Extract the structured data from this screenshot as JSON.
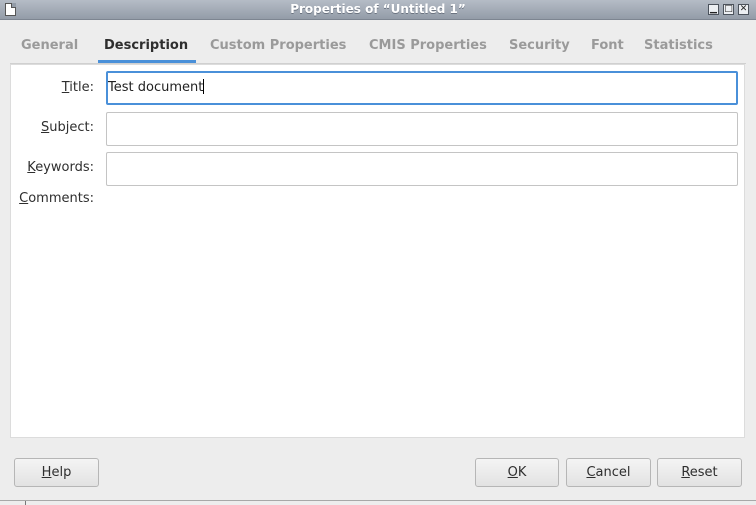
{
  "window": {
    "title": "Properties of “Untitled 1”",
    "controls": [
      "minimize",
      "maximize",
      "close"
    ]
  },
  "tabs": [
    {
      "label": "General",
      "active": false
    },
    {
      "label": "Description",
      "active": true
    },
    {
      "label": "Custom Properties",
      "active": false
    },
    {
      "label": "CMIS Properties",
      "active": false
    },
    {
      "label": "Security",
      "active": false
    },
    {
      "label": "Font",
      "active": false
    },
    {
      "label": "Statistics",
      "active": false
    }
  ],
  "form": {
    "title": {
      "label_mnemonic": "T",
      "label_rest": "itle:",
      "value": "Test document"
    },
    "subject": {
      "label_mnemonic": "S",
      "label_rest": "ubject:",
      "value": ""
    },
    "keywords": {
      "label_mnemonic": "K",
      "label_rest": "eywords:",
      "value": ""
    },
    "comments": {
      "label_mnemonic": "C",
      "label_rest": "omments:",
      "value": ""
    }
  },
  "buttons": {
    "help": {
      "mnemonic": "H",
      "rest": "elp"
    },
    "ok": {
      "mnemonic": "O",
      "rest": "K"
    },
    "cancel": {
      "mnemonic": "C",
      "rest": "ancel"
    },
    "reset": {
      "mnemonic": "R",
      "rest": "eset"
    }
  },
  "colors": {
    "accent": "#4a90d9",
    "titlebar": "#939ca8"
  }
}
